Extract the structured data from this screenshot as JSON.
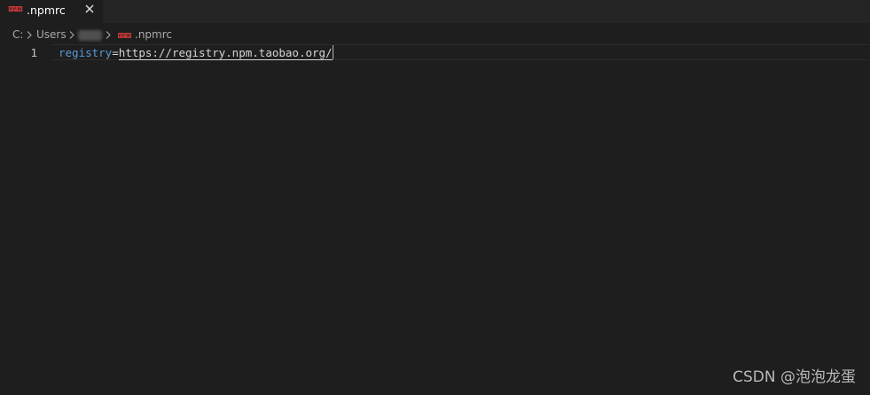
{
  "tab": {
    "label": ".npmrc",
    "file_icon": "npm-icon",
    "close_icon": "close-icon",
    "icon_color": "#cb3837"
  },
  "breadcrumb": {
    "items": [
      "C:",
      "Users",
      ".npmrc"
    ],
    "separator_icon": "chevron-right-icon",
    "file_icon": "npm-icon"
  },
  "editor": {
    "line_number": "1",
    "key": "registry",
    "equals": "=",
    "value": "https://registry.npm.taobao.org/",
    "key_color": "#569cd6"
  },
  "watermark": "CSDN @泡泡龙蛋"
}
